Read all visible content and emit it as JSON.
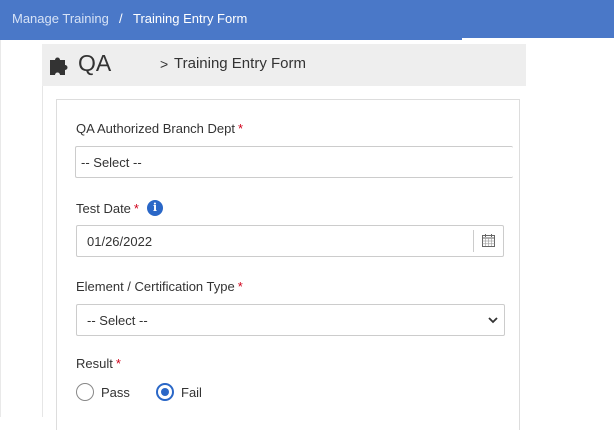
{
  "breadcrumb": {
    "link": "Manage Training",
    "separator": "/",
    "current": "Training Entry Form"
  },
  "header": {
    "icon": "puzzle-icon",
    "title": "QA",
    "separator": ">",
    "subtitle": "Training Entry Form"
  },
  "form": {
    "branch": {
      "label": "QA Authorized Branch Dept",
      "required": "*",
      "selected": "-- Select --"
    },
    "test_date": {
      "label": "Test Date",
      "required": "*",
      "info_icon": "i",
      "value": "01/26/2022",
      "icon": "calendar-icon"
    },
    "element": {
      "label": "Element / Certification Type",
      "required": "*",
      "selected": "-- Select --"
    },
    "result": {
      "label": "Result",
      "required": "*",
      "options": [
        {
          "label": "Pass",
          "checked": false
        },
        {
          "label": "Fail",
          "checked": true
        }
      ]
    }
  },
  "colors": {
    "topbar": "#4a78c8",
    "accent": "#2a67c7",
    "required": "#d0021b"
  }
}
